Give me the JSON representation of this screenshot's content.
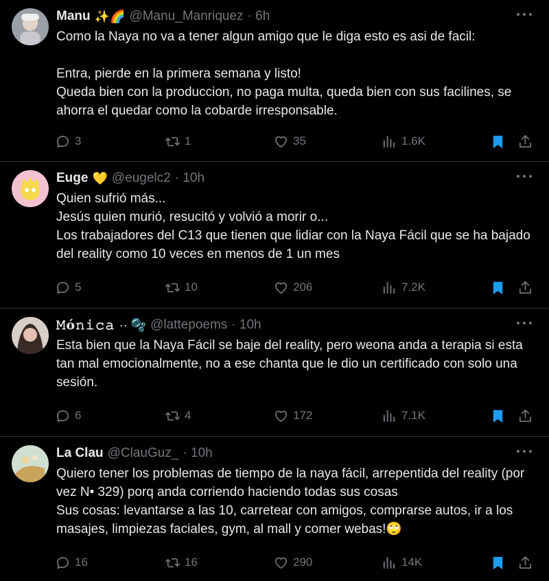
{
  "tweets": [
    {
      "name": "Manu",
      "emojis": "✨🌈",
      "handle": "@Manu_Manriquez",
      "time": "· 6h",
      "text": "Como la Naya no va a tener algun amigo que le diga esto es asi de facil:\n\nEntra, pierde en la primera semana y listo!\nQueda bien con la produccion, no paga multa, queda bien con sus facilines, se ahorra el quedar como la cobarde irresponsable.",
      "replies": "3",
      "retweets": "1",
      "likes": "35",
      "views": "1.6K",
      "avatar_color": "#8a8f9a"
    },
    {
      "name": "Euge",
      "emojis": "💛",
      "handle": "@eugelc2",
      "time": "· 10h",
      "text": "Quien sufrió más...\nJesús quien murió, resucitó y volvió a morir o...\nLos trabajadores del C13 que tienen que lidiar con la Naya Fácil que se ha bajado del reality como 10 veces en menos de 1 un mes",
      "replies": "5",
      "retweets": "10",
      "likes": "206",
      "views": "7.2K",
      "avatar_color": "#e7b5c8"
    },
    {
      "name": "𝙼ó𝚗𝚒𝚌𝚊",
      "emojis": "·· 🫧",
      "handle": "@lattepoems",
      "time": "· 10h",
      "text": "Esta bien que la Naya Fácil se baje del reality, pero weona anda a terapia si esta tan mal emocionalmente, no a ese chanta que le dio un certificado con solo una sesión.",
      "replies": "6",
      "retweets": "4",
      "likes": "172",
      "views": "7.1K",
      "avatar_color": "#5a4a48"
    },
    {
      "name": "La Clau",
      "emojis": "",
      "handle": "@ClauGuz_",
      "time": "· 10h",
      "text": "Quiero tener los problemas de tiempo de la naya fácil, arrepentida del reality (por vez N• 329) porq anda corriendo haciendo todas sus cosas\nSus cosas: levantarse a las 10, carretear con amigos, comprarse autos, ir a los masajes, limpiezas faciales, gym, al mall y comer webas!🙄",
      "replies": "16",
      "retweets": "16",
      "likes": "290",
      "views": "14K",
      "avatar_color": "#b9c9b0"
    }
  ],
  "colors": {
    "text": "#e7e9ea",
    "muted": "#71767b",
    "bookmark": "#1d9bf0",
    "divider": "#2f3336"
  }
}
